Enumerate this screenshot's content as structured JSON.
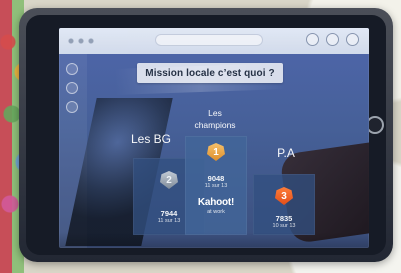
{
  "screen": {
    "question": "Mission locale c’est quoi ?"
  },
  "podium": {
    "left": {
      "name": "Les BG",
      "rank": "2",
      "score": "7944",
      "detail": "11 sur 13"
    },
    "middle": {
      "name_line_1": "Les",
      "name_line_2": "champions",
      "rank": "1",
      "score": "9048",
      "detail": "11 sur 13"
    },
    "right": {
      "name": "P.A",
      "rank": "3",
      "score": "7835",
      "detail": "10 sur 13"
    }
  },
  "brand": {
    "title": "Kahoot!",
    "subtitle": "at work"
  },
  "colors": {
    "screen_blue": "#4f66ac",
    "podium_blue": "#324f80",
    "gold_badge": "#e59a35",
    "silver_badge": "#8e9aa9",
    "bronze_badge": "#ea5a22"
  }
}
